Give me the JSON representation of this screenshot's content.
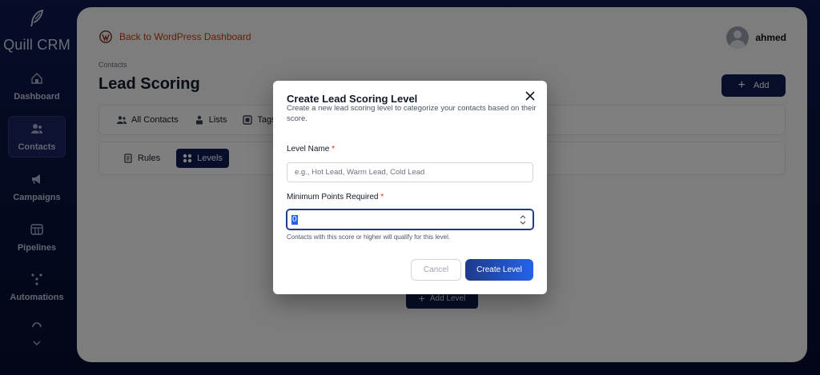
{
  "sidebar": {
    "brand": "Quill CRM",
    "items": [
      {
        "label": "Dashboard",
        "icon": "dashboard-icon"
      },
      {
        "label": "Contacts",
        "icon": "contacts-icon",
        "active": true
      },
      {
        "label": "Campaigns",
        "icon": "megaphone-icon"
      },
      {
        "label": "Pipelines",
        "icon": "pipeline-icon"
      },
      {
        "label": "Automations",
        "icon": "automation-icon"
      }
    ]
  },
  "header": {
    "back_label": "Back to WordPress Dashboard",
    "username": "ahmed"
  },
  "page": {
    "breadcrumb": "Contacts",
    "title": "Lead Scoring",
    "add_label": "Add",
    "tabs": [
      {
        "label": "All Contacts",
        "icon": "users-icon"
      },
      {
        "label": "Lists",
        "icon": "list-icon"
      },
      {
        "label": "Tags",
        "icon": "tag-icon"
      }
    ],
    "subtabs": [
      {
        "label": "Rules",
        "icon": "rules-icon"
      },
      {
        "label": "Levels",
        "icon": "grid-icon",
        "active": true
      }
    ],
    "add_level_label": "Add Level"
  },
  "modal": {
    "title": "Create Lead Scoring Level",
    "description": "Create a new lead scoring level to categorize your contacts based on their score.",
    "level_name_label": "Level Name",
    "level_name_placeholder": "e.g., Hot Lead, Warm Lead, Cold Lead",
    "level_name_value": "",
    "min_points_label": "Minimum Points Required",
    "min_points_value": "0",
    "required_mark": "*",
    "hint": "Contacts with this score or higher will qualify for this level.",
    "cancel_label": "Cancel",
    "create_label": "Create Level"
  },
  "colors": {
    "accent": "#0f1d55",
    "primary_button": "#2563eb",
    "required": "#dc2626",
    "link": "#c2410c"
  }
}
